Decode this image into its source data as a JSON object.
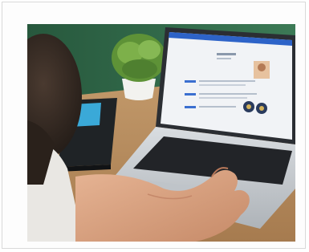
{
  "photo": {
    "description_hidden": true,
    "scene": "person-typing-on-laptop",
    "colors": {
      "wall": "#2f6b4a",
      "desk": "#b58a5c",
      "laptop_body": "#c9cdd1",
      "keyboard": "#222428",
      "screen": "#f1f3f6",
      "skin": "#d9a07f",
      "notebook": "#1f2326",
      "notebook_band": "#3aa9d8",
      "plant": "#6fa340",
      "pot": "#f2f2ef"
    }
  }
}
